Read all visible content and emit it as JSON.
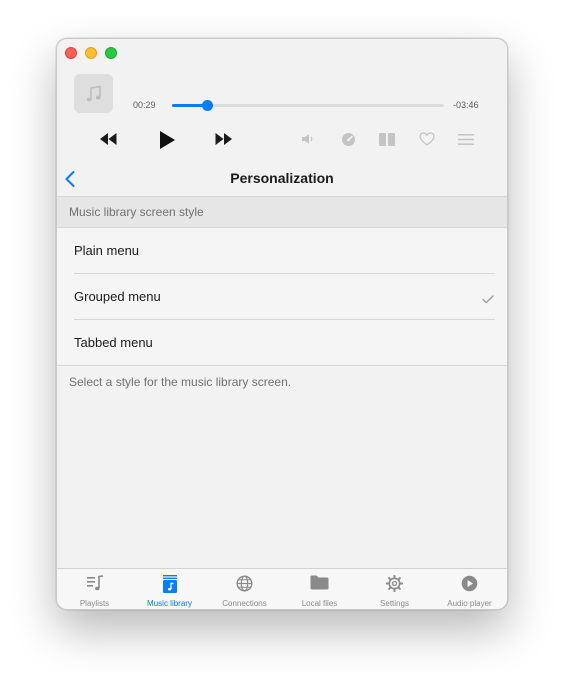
{
  "window": {
    "controls": [
      "close",
      "minimize",
      "zoom"
    ]
  },
  "player": {
    "artwork_icon": "music-note-icon",
    "elapsed": "00:29",
    "remaining": "-03:46",
    "progress": 0.13,
    "controls": [
      "rewind-icon",
      "play-icon",
      "fast-forward-icon",
      "volume-icon",
      "speed-icon",
      "equalizer-icon",
      "heart-icon",
      "menu-icon"
    ],
    "accent_color": "#0a7aff"
  },
  "nav": {
    "back_icon": "chevron-left-icon",
    "title": "Personalization"
  },
  "section": {
    "header": "Music library screen style",
    "options": [
      {
        "label": "Plain menu",
        "selected": false
      },
      {
        "label": "Grouped menu",
        "selected": true
      },
      {
        "label": "Tabbed menu",
        "selected": false
      }
    ],
    "footer": "Select a style for the music library screen."
  },
  "tabs": [
    {
      "label": "Playlists",
      "icon": "playlist-icon",
      "active": false
    },
    {
      "label": "Music library",
      "icon": "music-library-icon",
      "active": true
    },
    {
      "label": "Connections",
      "icon": "globe-icon",
      "active": false
    },
    {
      "label": "Local files",
      "icon": "folder-icon",
      "active": false
    },
    {
      "label": "Settings",
      "icon": "gear-icon",
      "active": false
    },
    {
      "label": "Audio player",
      "icon": "play-circle-icon",
      "active": false
    }
  ]
}
